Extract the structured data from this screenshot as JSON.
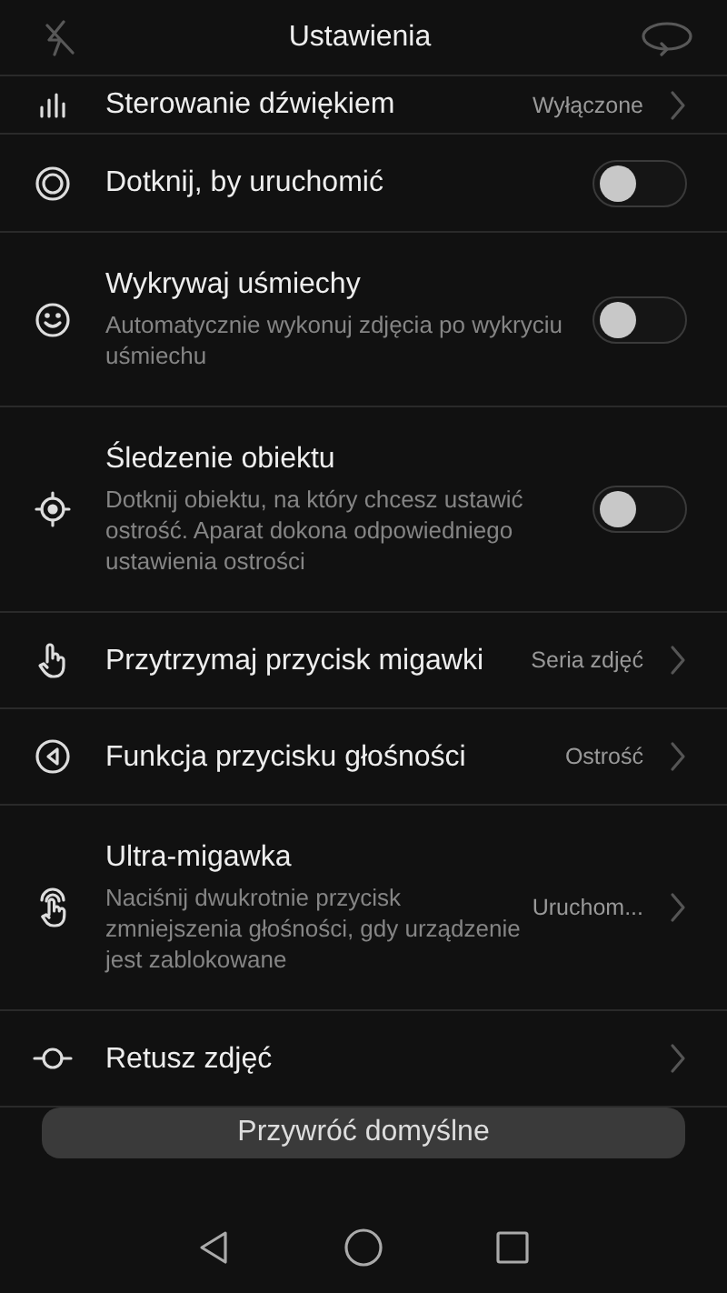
{
  "header": {
    "title": "Ustawienia"
  },
  "settings": [
    {
      "kind": "value",
      "title": "Sterowanie dźwiękiem",
      "value": "Wyłączone"
    },
    {
      "kind": "toggle",
      "title": "Dotknij, by uruchomić",
      "on": false
    },
    {
      "kind": "toggle",
      "title": "Wykrywaj uśmiechy",
      "description": "Automatycznie wykonuj zdjęcia po wykryciu uśmiechu",
      "on": false
    },
    {
      "kind": "toggle",
      "title": "Śledzenie obiektu",
      "description": "Dotknij obiektu, na który chcesz ustawić ostrość. Aparat dokona odpowiedniego ustawienia ostrości",
      "on": false
    },
    {
      "kind": "value",
      "title": "Przytrzymaj przycisk migawki",
      "value": "Seria zdjęć"
    },
    {
      "kind": "value",
      "title": "Funkcja przycisku głośności",
      "value": "Ostrość"
    },
    {
      "kind": "value",
      "title": "Ultra-migawka",
      "description": "Naciśnij dwukrotnie przycisk zmniejszenia głośności, gdy urządzenie jest zablokowane",
      "value": "Uruchom..."
    },
    {
      "kind": "value",
      "title": "Retusz zdjęć"
    }
  ],
  "reset_button": "Przywróć domyślne"
}
